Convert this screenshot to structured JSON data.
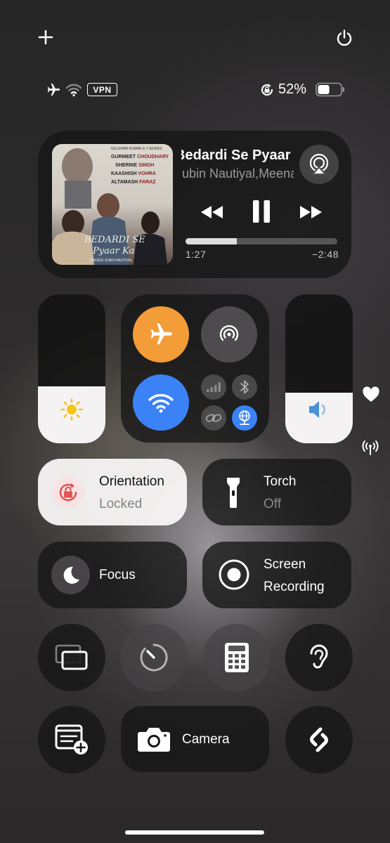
{
  "colors": {
    "accent_blue": "#3b82f6",
    "airplane_orange": "#f29d38",
    "sun_yellow": "#f5c518",
    "speaker_blue": "#4a90d9",
    "lock_red": "#e05555"
  },
  "top": {
    "add_icon": "plus-icon",
    "power_icon": "power-icon"
  },
  "status": {
    "vpn": "VPN",
    "battery_percent": "52%",
    "battery_level": 0.52
  },
  "media": {
    "title": "Bedardi Se Pyaar Ka",
    "artist": "Jubin Nautiyal,Meena",
    "elapsed": "1:27",
    "remaining": "−2:48",
    "progress": 0.34,
    "album_art": {
      "top_credit": "GULSHAN KUMAR & T-SERIES",
      "cast": [
        {
          "first": "GURMEET",
          "last": "CHOUDHARY"
        },
        {
          "first": "SHERINE",
          "last": "SINGH"
        },
        {
          "first": "KAASHISH",
          "last": "VOHRA"
        },
        {
          "first": "ALTAMASH",
          "last": "FARAZ"
        }
      ],
      "film_title_line1": "BEDARDI SE",
      "film_title_line2": "Pyaar Ka",
      "singer_credit": "SINGER JUBIN NAUTIYAL"
    }
  },
  "brightness": {
    "level": 0.38
  },
  "volume": {
    "level": 0.34
  },
  "tiles": {
    "orientation": {
      "title": "Orientation",
      "subtitle": "Locked"
    },
    "torch": {
      "title": "Torch",
      "subtitle": "Off"
    },
    "focus": {
      "title": "Focus"
    },
    "screen_recording": {
      "title_line1": "Screen",
      "title_line2": "Recording"
    },
    "camera": {
      "label": "Camera"
    }
  }
}
